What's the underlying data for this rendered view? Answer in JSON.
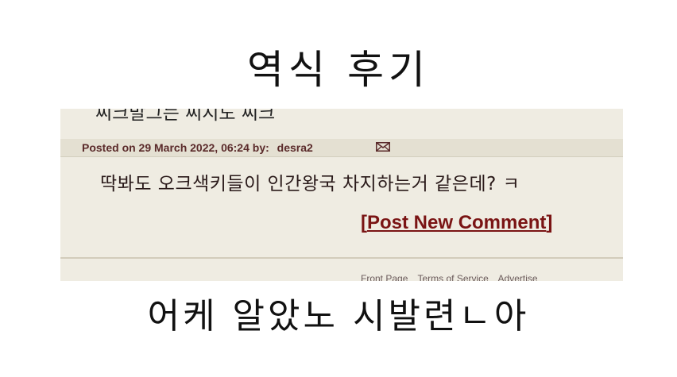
{
  "captions": {
    "top": "역식 후기",
    "bottom": "어케 알았노 시발련ㄴ아"
  },
  "screenshot": {
    "cut_off_text": "씨크발그는 씨지도 씨크",
    "posted_prefix": "Posted on 29 March 2022, 06:24 by:",
    "author": "desra2",
    "comment": "딱봐도 오크색키들이 인간왕국 차지하는거 같은데? ㅋ",
    "post_link": "Post New Comment",
    "bracket_open": "[",
    "bracket_close": "]",
    "footer_links": [
      "Front Page",
      "Terms of Service",
      "Advertise"
    ],
    "colors": {
      "background": "#efece2",
      "link": "#7a1414",
      "meta": "#5a2a2a"
    }
  }
}
